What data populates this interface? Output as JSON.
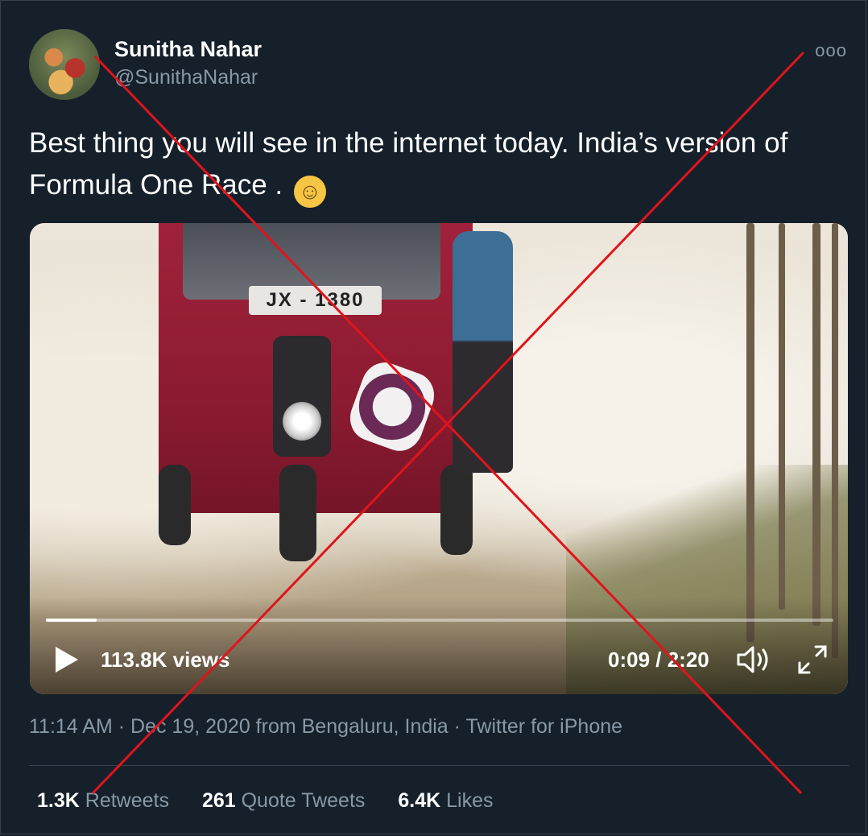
{
  "author": {
    "name": "Sunitha Nahar",
    "handle": "@SunithaNahar"
  },
  "more_icon": "ooo",
  "tweet_text": "Best thing you will see in the internet today.  India’s version of Formula One Race .",
  "emoji": "😁",
  "video": {
    "plate_text": "JX - 1380",
    "views": "113.8K views",
    "time": "0:09 / 2:20",
    "progress": 0.064,
    "play_icon": "play-icon",
    "volume_icon": "volume-icon",
    "fullscreen_icon": "fullscreen-icon"
  },
  "meta": {
    "time": "11:14 AM",
    "date_location": "Dec 19, 2020 from Bengaluru, India",
    "source": "Twitter for iPhone",
    "separator": "·"
  },
  "stats": {
    "retweets_count": "1.3K",
    "retweets_label": "Retweets",
    "quotes_count": "261",
    "quotes_label": "Quote Tweets",
    "likes_count": "6.4K",
    "likes_label": "Likes"
  },
  "colors": {
    "background": "#15202b",
    "secondary_text": "#8899a6",
    "cross_mark": "#e0141b"
  }
}
